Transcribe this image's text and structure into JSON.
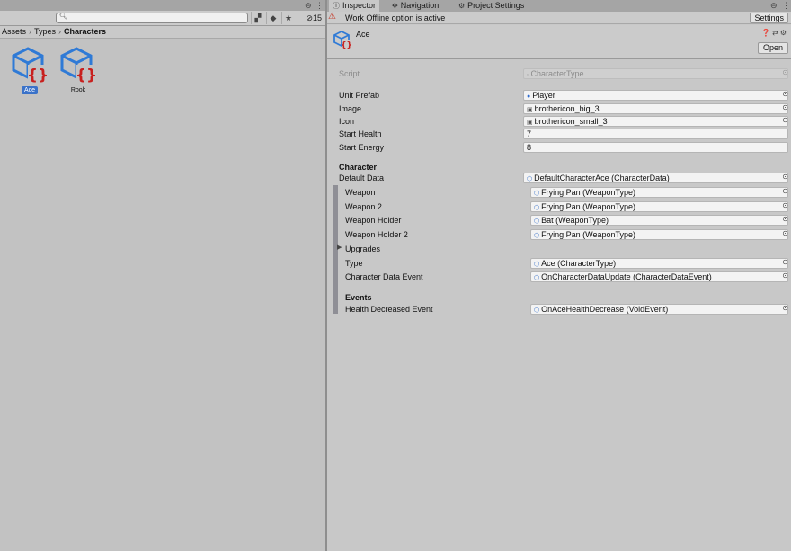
{
  "project": {
    "search": {
      "placeholder": ""
    },
    "hidden_count": "15",
    "breadcrumb": [
      "Assets",
      "Types",
      "Characters"
    ],
    "assets": [
      {
        "name": "Ace",
        "selected": true
      },
      {
        "name": "Rook",
        "selected": false
      }
    ]
  },
  "inspector": {
    "tabs": [
      {
        "label": "Inspector",
        "icon": "info-icon",
        "active": true
      },
      {
        "label": "Navigation",
        "icon": "navigation-icon",
        "active": false
      },
      {
        "label": "Project Settings",
        "icon": "gear-icon",
        "active": false
      }
    ],
    "offline_text": "Work Offline option is active",
    "settings_label": "Settings",
    "object_name": "Ace",
    "open_label": "Open",
    "script": {
      "label": "Script",
      "value": "CharacterType"
    },
    "unit_prefab": {
      "label": "Unit Prefab",
      "value": "Player"
    },
    "image": {
      "label": "Image",
      "value": "brothericon_big_3"
    },
    "icon": {
      "label": "Icon",
      "value": "brothericon_small_3"
    },
    "start_health": {
      "label": "Start Health",
      "value": "7"
    },
    "start_energy": {
      "label": "Start Energy",
      "value": "8"
    },
    "character_header": "Character",
    "default_data": {
      "label": "Default Data",
      "value": "DefaultCharacterAce (CharacterData)"
    },
    "weapon": {
      "label": "Weapon",
      "value": "Frying Pan (WeaponType)"
    },
    "weapon2": {
      "label": "Weapon 2",
      "value": "Frying Pan (WeaponType)"
    },
    "weapon_holder": {
      "label": "Weapon Holder",
      "value": "Bat (WeaponType)"
    },
    "weapon_holder2": {
      "label": "Weapon Holder 2",
      "value": "Frying Pan (WeaponType)"
    },
    "upgrades": {
      "label": "Upgrades"
    },
    "type": {
      "label": "Type",
      "value": "Ace (CharacterType)"
    },
    "character_data_event": {
      "label": "Character Data Event",
      "value": "OnCharacterDataUpdate (CharacterDataEvent)"
    },
    "events_header": "Events",
    "health_decreased_event": {
      "label": "Health Decreased Event",
      "value": "OnAceHealthDecrease (VoidEvent)"
    }
  },
  "colors": {
    "selection": "#3a72c9",
    "warning": "#c4301e",
    "asset_icon_blue": "#2f7ad6",
    "asset_icon_red": "#c8201e"
  }
}
